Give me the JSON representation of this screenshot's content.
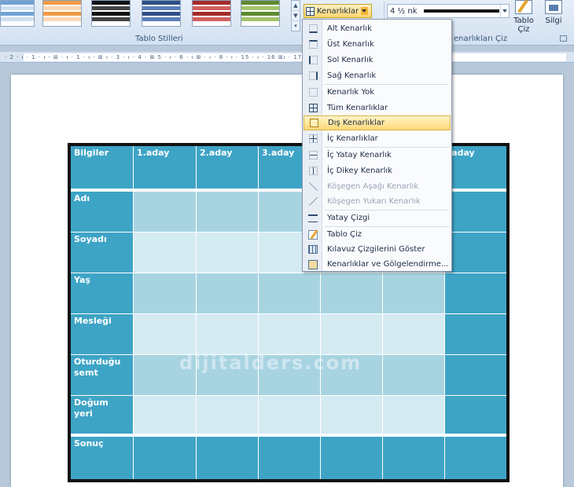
{
  "ribbon": {
    "group_table_styles": "Tablo Stilleri",
    "group_draw_borders": "enarlıkları Çiz",
    "borders_button": "Kenarlıklar",
    "pen_weight": "4 ½ nk",
    "draw_table_label": "Tablo\nÇiz",
    "eraser_label": "Silgi"
  },
  "ruler": {
    "text": "· 2 · ı · 1 · ı · ⊞ · ı · 1 · ı · ⊞ ı · 3 · ı · 4 · ⊞ 5 · ı · 6 · ı ⊞ · ı · 8 · ı        · 15 · ı · 16 ⊞ı · 17 · ı · 18 · ı"
  },
  "menu": {
    "items": [
      {
        "label": "Alt Kenarlık",
        "icon": "border-bottom-icon",
        "disabled": false
      },
      {
        "label": "Üst Kenarlık",
        "icon": "border-top-icon",
        "disabled": false
      },
      {
        "label": "Sol Kenarlık",
        "icon": "border-left-icon",
        "disabled": false
      },
      {
        "label": "Sağ Kenarlık",
        "icon": "border-right-icon",
        "disabled": false
      },
      {
        "label": "Kenarlık Yok",
        "icon": "border-none-icon",
        "disabled": false
      },
      {
        "label": "Tüm Kenarlıklar",
        "icon": "border-all-icon",
        "disabled": false
      },
      {
        "label": "Dış Kenarlıklar",
        "icon": "border-outside-icon",
        "disabled": false,
        "highlighted": true
      },
      {
        "label": "İç Kenarlıklar",
        "icon": "border-inside-icon",
        "disabled": false
      },
      {
        "label": "İç Yatay Kenarlık",
        "icon": "border-inside-horizontal-icon",
        "disabled": false
      },
      {
        "label": "İç Dikey Kenarlık",
        "icon": "border-inside-vertical-icon",
        "disabled": false
      },
      {
        "label": "Köşegen Aşağı Kenarlık",
        "icon": "diagonal-down-icon",
        "disabled": true
      },
      {
        "label": "Köşegen Yukarı Kenarlık",
        "icon": "diagonal-up-icon",
        "disabled": true
      },
      {
        "label": "Yatay Çizgi",
        "icon": "horizontal-line-icon",
        "disabled": false
      },
      {
        "label": "Tablo Çiz",
        "icon": "draw-table-icon",
        "disabled": false
      },
      {
        "label": "Kılavuz Çizgilerini Göster",
        "icon": "view-gridlines-icon",
        "disabled": false
      },
      {
        "label": "Kenarlıklar ve Gölgelendirme...",
        "icon": "borders-shading-icon",
        "disabled": false
      }
    ]
  },
  "table": {
    "headers": [
      "Bilgiler",
      "1.aday",
      "2.aday",
      "3.aday",
      "",
      "",
      ".aday"
    ],
    "rows": [
      "Adı",
      "Soyadı",
      "Yaş",
      "Mesleği",
      "Oturduğu\nsemt",
      "Doğum yeri",
      "Sonuç"
    ]
  },
  "watermark": "dijitalders.com",
  "colors": {
    "table_dark": "#3ea4c6",
    "table_light1": "#a8d4e2",
    "table_light2": "#d5ebf2",
    "menu_highlight": "#ffd977"
  }
}
